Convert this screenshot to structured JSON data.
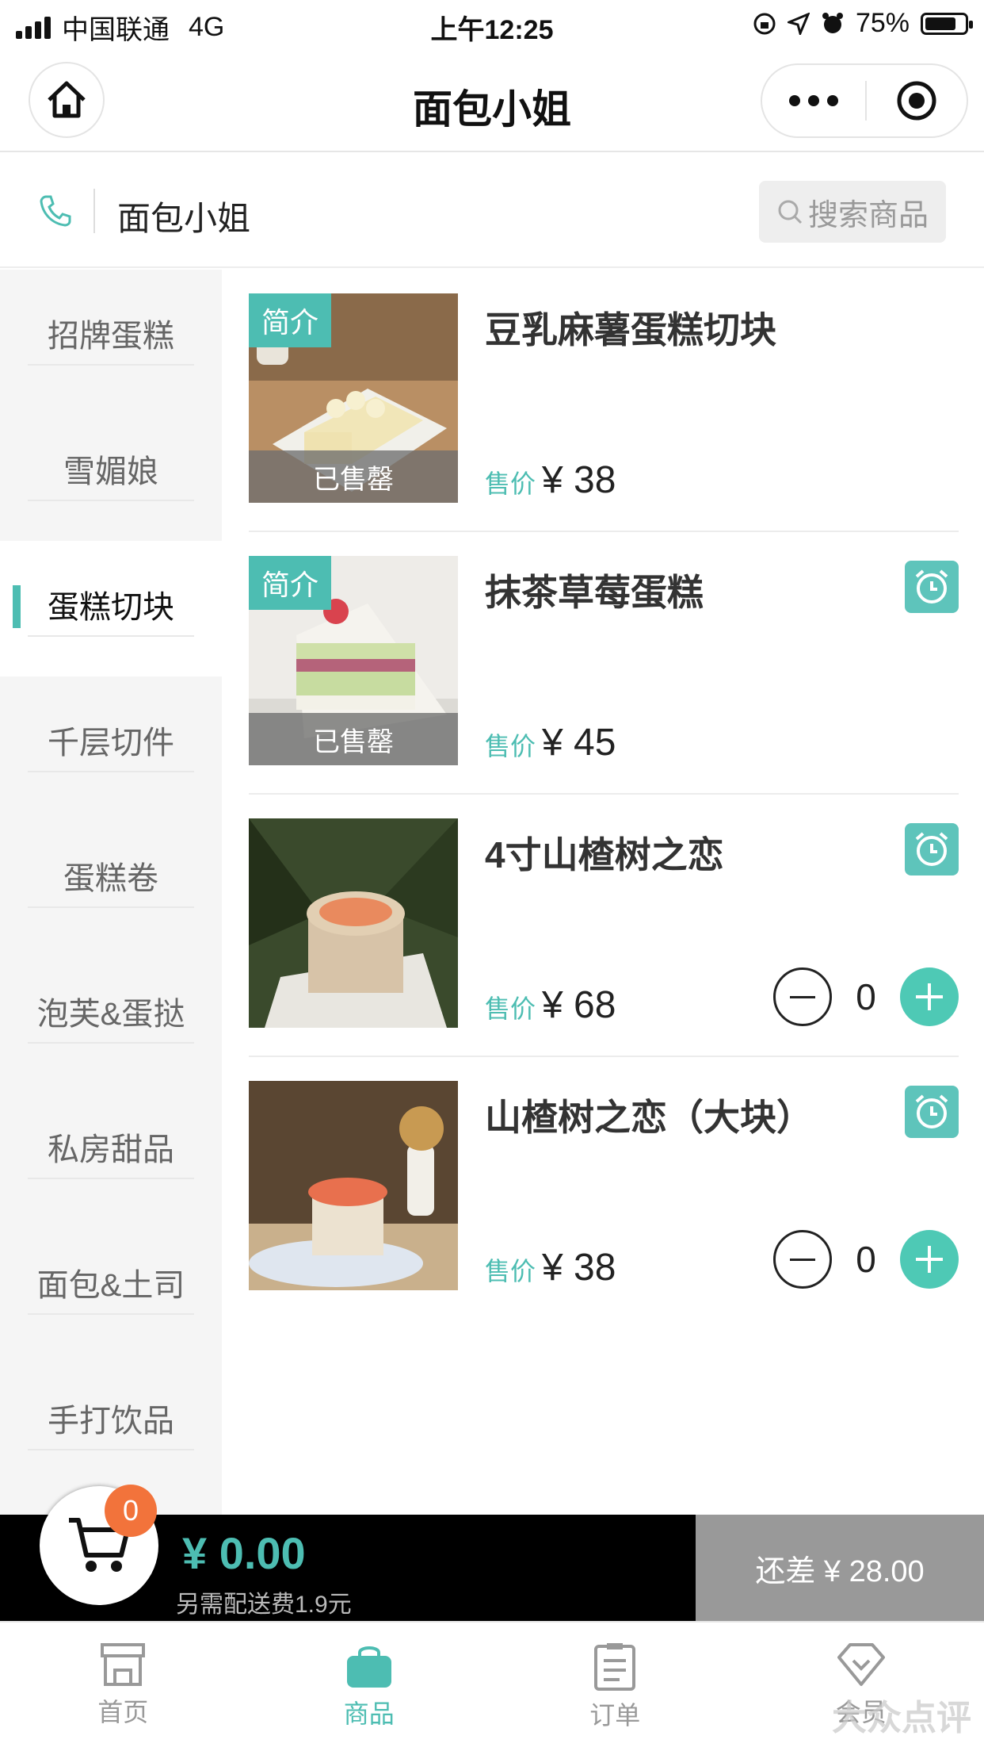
{
  "status_bar": {
    "carrier": "中国联通",
    "network": "4G",
    "time": "上午12:25",
    "battery": "75%"
  },
  "nav": {
    "title": "面包小姐"
  },
  "shop": {
    "name": "面包小姐",
    "search_placeholder": "搜索商品"
  },
  "categories": [
    {
      "label": "招牌蛋糕"
    },
    {
      "label": "雪媚娘"
    },
    {
      "label": "蛋糕切块",
      "active": true
    },
    {
      "label": "千层切件"
    },
    {
      "label": "蛋糕卷"
    },
    {
      "label": "泡芙&蛋挞"
    },
    {
      "label": "私房甜品"
    },
    {
      "label": "面包&土司"
    },
    {
      "label": "手打饮品"
    }
  ],
  "products": [
    {
      "name": "豆乳麻薯蛋糕切块",
      "price_label": "售价",
      "price": "¥ 38",
      "tag": "简介",
      "sold_out": "已售罄"
    },
    {
      "name": "抹茶草莓蛋糕",
      "price_label": "售价",
      "price": "¥ 45",
      "tag": "简介",
      "sold_out": "已售罄"
    },
    {
      "name": "4寸山楂树之恋",
      "price_label": "售价",
      "price": "¥ 68",
      "qty": "0"
    },
    {
      "name": "山楂树之恋（大块）",
      "price_label": "售价",
      "price": "¥ 38",
      "qty": "0"
    }
  ],
  "cart": {
    "count": "0",
    "total": "¥ 0.00",
    "delivery_fee": "另需配送费1.9元",
    "remaining": "还差 ¥ 28.00"
  },
  "tabs": [
    {
      "label": "首页"
    },
    {
      "label": "商品",
      "active": true
    },
    {
      "label": "订单"
    },
    {
      "label": "会员"
    }
  ],
  "watermark": "大众点评",
  "colors": {
    "accent": "#4dbdb2",
    "badge": "#f2733b",
    "cart_bar": "#000000",
    "remaining_bg": "#999999"
  }
}
